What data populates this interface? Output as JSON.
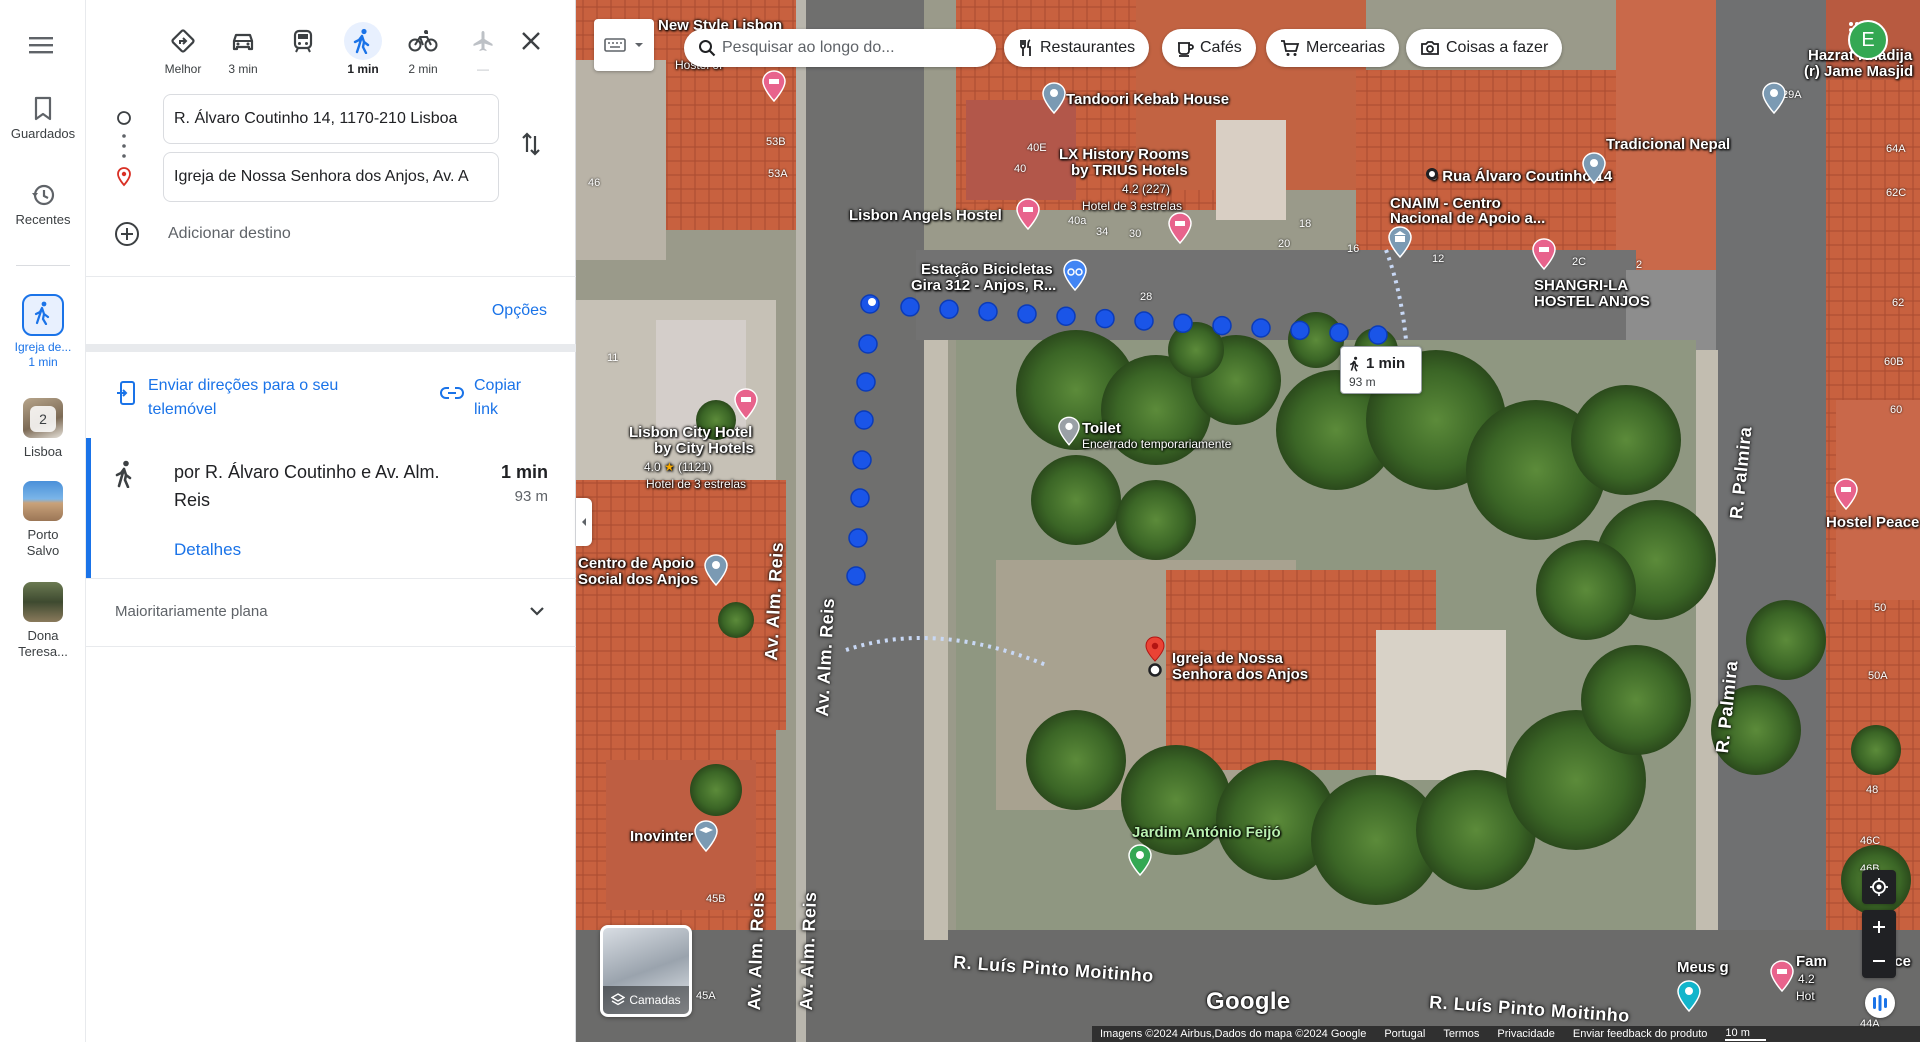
{
  "rail": {
    "menu_icon": "menu-icon",
    "saved_label": "Guardados",
    "recent_label": "Recentes",
    "current_trip_label": "Igreja de...",
    "current_trip_time": "1 min",
    "lisboa_label": "Lisboa",
    "lisboa_badge": "2",
    "porto_salvo_label": "Porto Salvo",
    "dona_teresa_label": "Dona Teresa..."
  },
  "panel": {
    "modes": [
      {
        "name": "best",
        "label": "Melhor"
      },
      {
        "name": "car",
        "label": "3 min"
      },
      {
        "name": "transit",
        "label": ""
      },
      {
        "name": "walk",
        "label": "1 min"
      },
      {
        "name": "bike",
        "label": "2 min"
      },
      {
        "name": "flight",
        "label": "—"
      }
    ],
    "origin_value": "R. Álvaro Coutinho 14, 1170-210 Lisboa",
    "destination_value": "Igreja de Nossa Senhora dos Anjos, Av. A",
    "add_destination": "Adicionar destino",
    "options": "Opções",
    "send_to_phone": "Enviar direções para o seu telemóvel",
    "copy_link": "Copiar link",
    "route_via": "por R. Álvaro Coutinho e Av. Alm. Reis",
    "route_time": "1 min",
    "route_distance": "93 m",
    "details": "Detalhes",
    "terrain": "Maioritariamente plana"
  },
  "map": {
    "search_placeholder": "Pesquisar ao longo do...",
    "chips": [
      "Restaurantes",
      "Cafés",
      "Mercearias",
      "Coisas a fazer"
    ],
    "avatar_letter": "E",
    "route_bubble_time": "1 min",
    "route_bubble_dist": "93 m",
    "labels": {
      "new_style": "New Style Lisbon",
      "hostel_of": "Hostel of",
      "tandoori": "Tandoori Kebab House",
      "lx_history": "LX History Rooms",
      "by_trius": "by TRIUS Hotels",
      "lx_rating": "4.2",
      "lx_count": "(227)",
      "lx_type": "Hotel de 3 estrelas",
      "lisbon_angels": "Lisbon Angels Hostel",
      "estacao1": "Estação Bicicletas",
      "estacao2": "Gira 312 - Anjos, R...",
      "rua_alvaro": "Rua Álvaro Coutinho 14",
      "cnaim1": "CNAIM - Centro",
      "cnaim2": "Nacional de Apoio a...",
      "tradicional": "Tradicional Nepal",
      "hazrat1": "Hazrat Khadija",
      "hazrat2": "(r) Jame Masjid",
      "shangri1": "SHANGRI-LA",
      "shangri2": "HOSTEL ANJOS",
      "toilet": "Toilet",
      "toilet_sub": "Encerrado temporariamente",
      "lisbon_city1": "Lisbon City Hotel",
      "lisbon_city2": "by City Hotels",
      "lisbon_city_rating": "4.0",
      "lisbon_city_count": "(1121)",
      "lisbon_city_type": "Hotel de 3 estrelas",
      "centro_apoio1": "Centro de Apoio",
      "centro_apoio2": "Social dos Anjos",
      "igreja1": "Igreja de Nossa",
      "igreja2": "Senhora dos Anjos",
      "hostel_peace": "Hostel Peace",
      "jardim": "Jardim António Feijó",
      "inovinter": "Inovinter",
      "meus": "Meus g",
      "fam": "Fam",
      "ace": "ace",
      "fam_rating": "4.2",
      "hot": "Hot"
    },
    "streets": {
      "alm_reis_a": "Av. Alm. Reis",
      "alm_reis_b": "Av. Alm. Reis",
      "alm_reis_c": "Av. Alm. Reis",
      "alm_reis_d": "Av. Alm. Reis",
      "palmira_a": "R. Palmira",
      "palmira_b": "R. Palmira",
      "pinto_a": "R. Luís Pinto Moitinho",
      "pinto_b": "R. Luís Pinto Moitinho"
    },
    "numbers": [
      "53B",
      "53A",
      "46",
      "40",
      "40E",
      "40a",
      "34",
      "30",
      "18",
      "20",
      "16",
      "12",
      "2C",
      "2",
      "28",
      "11",
      "29A",
      "64A",
      "62C",
      "62",
      "60B",
      "60",
      "50",
      "50A",
      "48",
      "46C",
      "46B",
      "44A",
      "45B",
      "45A"
    ],
    "layers_label": "Camadas",
    "google_logo": "Google",
    "footer": {
      "imagery": "Imagens ©2024 Airbus,Dados do mapa ©2024 Google",
      "country": "Portugal",
      "terms": "Termos",
      "privacy": "Privacidade",
      "feedback": "Enviar feedback do produto",
      "scale": "10 m"
    }
  }
}
